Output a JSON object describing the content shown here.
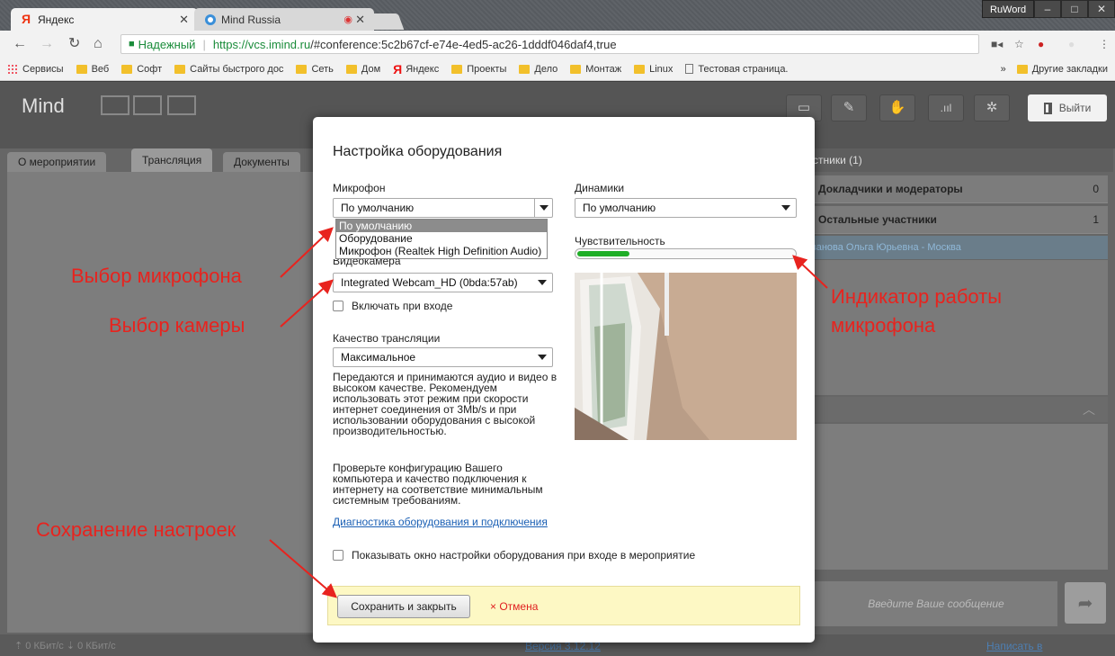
{
  "browser": {
    "tabs": [
      {
        "label": "Яндекс",
        "favicon_text": "Я"
      },
      {
        "label": "Mind Russia"
      }
    ],
    "ruword": "RuWord",
    "address": {
      "secure_label": "Надежный",
      "url_host": "https://vcs.imind.ru",
      "url_rest": "/#conference:5c2b67cf-e74e-4ed5-ac26-1dddf046daf4,true"
    },
    "bookmarks": [
      "Сервисы",
      "Веб",
      "Софт",
      "Сайты быстрого дос",
      "Сеть",
      "Дом",
      "Яндекс",
      "Проекты",
      "Дело",
      "Монтаж",
      "Linux",
      "Тестовая страница."
    ],
    "bookmarks_more": "»",
    "other_bookmarks": "Другие закладки"
  },
  "app": {
    "logo": "Mind",
    "exit_label": "Выйти",
    "tabs": [
      "О мероприятии",
      "Трансляция",
      "Документы"
    ],
    "participants_title": "стники (1)",
    "groups": [
      {
        "label": "Докладчики и модераторы",
        "count": "0"
      },
      {
        "label": "Остальные участники",
        "count": "1"
      }
    ],
    "participant": "ванова Ольга Юрьевна - Москва",
    "chat_placeholder": "Введите Ваше сообщение",
    "speed": "⇡ 0 КБит/с  ⇣ 0 КБит/с",
    "version": "Версия 3.12.12",
    "support": "Написать в техподдержку"
  },
  "modal": {
    "title": "Настройка оборудования",
    "mic_label": "Микрофон",
    "mic_value": "По умолчанию",
    "mic_options": [
      "По умолчанию",
      "Оборудование",
      "Микрофон (Realtek High Definition Audio)"
    ],
    "speakers_label": "Динамики",
    "speakers_value": "По умолчанию",
    "sensitivity_label": "Чувствительность",
    "sensitivity_level": 0.24,
    "camera_label": "Видеокамера",
    "camera_value": "Integrated Webcam_HD (0bda:57ab)",
    "camera_on_enter": "Включать при входе",
    "quality_label": "Качество трансляции",
    "quality_value": "Максимальное",
    "quality_desc": "Передаются и принимаются аудио и видео в высоком качестве. Рекомендуем использовать этот режим при скорости интернет соединения от 3Mb/s и при использовании оборудования с высокой производительностью.",
    "check_desc": "Проверьте конфигурацию Вашего компьютера и качество подключения к интернету на соответствие минимальным системным требованиям.",
    "diag_link": "Диагностика оборудования и подключения",
    "show_on_enter": "Показывать окно настройки оборудования при входе в мероприятие",
    "save_label": "Сохранить и закрыть",
    "cancel_label": "× Отмена"
  },
  "annotations": {
    "mic_select": "Выбор микрофона",
    "camera_select": "Выбор камеры",
    "mic_indicator_line1": "Индикатор работы",
    "mic_indicator_line2": "микрофона",
    "save_settings": "Сохранение настроек"
  },
  "colors": {
    "annotation": "#e8231e",
    "sensitivity": "#1fae27",
    "link": "#1a5fb4",
    "footer_bg": "#fdf8c4"
  }
}
